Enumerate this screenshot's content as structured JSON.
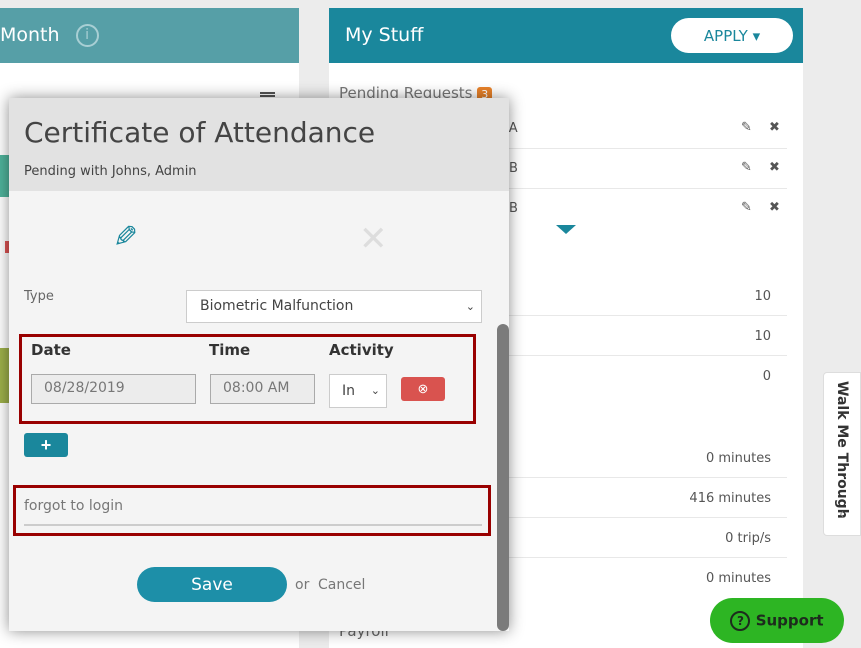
{
  "left_card": {
    "title": "Month",
    "info_icon": "info-icon"
  },
  "right_card": {
    "title": "My Stuff",
    "apply_label": "APPLY",
    "pending_label": "Pending Requests",
    "pending_count": "3",
    "pending_rows": [
      {
        "text": "DA"
      },
      {
        "text": "B"
      },
      {
        "text": "B"
      }
    ],
    "values": [
      "10",
      "10",
      "0",
      "0 minutes",
      "416 minutes",
      "0 trip/s",
      "0 minutes"
    ],
    "footer_partial": "Payroll"
  },
  "modal": {
    "title": "Certificate of Attendance",
    "subtitle": "Pending with Johns, Admin",
    "type_label": "Type",
    "type_value": "Biometric Malfunction",
    "date_label": "Date",
    "time_label": "Time",
    "activity_label": "Activity",
    "date_value": "08/28/2019",
    "time_value": "08:00 AM",
    "activity_value": "In",
    "reason_value": "forgot to login",
    "save_label": "Save",
    "or_label": "or",
    "cancel_label": "Cancel"
  },
  "walk_me_through": "Walk Me Through",
  "support_label": "Support",
  "colors": {
    "teal": "#1a879c",
    "danger": "#d9534f",
    "support": "#2db523",
    "highlight": "#990000"
  }
}
